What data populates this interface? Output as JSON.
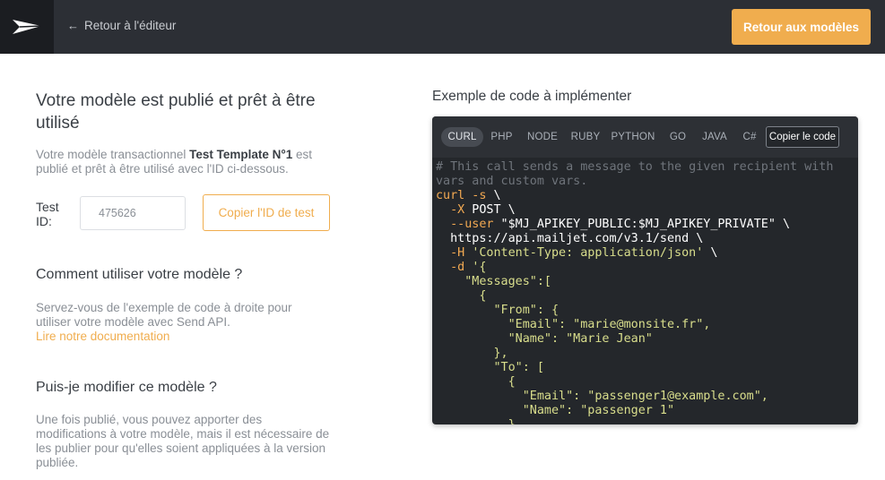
{
  "colors": {
    "topbar": "#2c2f35",
    "logo_box": "#1b1d21",
    "accent": "#f0ad4e",
    "code_bg": "#24272b",
    "code_keyword": "#f2a952",
    "code_string": "#d9de8c",
    "code_comment": "#6f747b"
  },
  "header": {
    "logo_icon": "paper-plane-icon",
    "back_icon": "arrow-left-icon",
    "back_label": "Retour à l'éditeur",
    "primary_button": "Retour aux modèles"
  },
  "left": {
    "title": "Votre modèle est publié et prêt à être utilisé",
    "desc_prefix": "Votre modèle transactionnel ",
    "template_name": "Test Template N°1",
    "desc_suffix": " est publié et prêt à être utilisé avec l'ID ci-dessous.",
    "test_id_label": "Test ID:",
    "test_id_value": "475626",
    "copy_id_button": "Copier l'ID de test",
    "how_title": "Comment utiliser votre modèle ?",
    "how_text": "Servez-vous de l'exemple de code à droite pour utiliser votre modèle avec Send API.",
    "how_link": "Lire notre documentation",
    "modify_title": "Puis-je modifier ce modèle ?",
    "modify_text": "Une fois publié, vous pouvez apporter des modifications à votre modèle, mais il est nécessaire de les publier pour qu'elles soient appliquées à la version publiée."
  },
  "code": {
    "title": "Exemple de code à implémenter",
    "tabs": [
      "CURL",
      "PHP",
      "NODE",
      "RUBY",
      "PYTHON",
      "GO",
      "JAVA",
      "C#"
    ],
    "active_tab": "CURL",
    "copy_button": "Copier le code",
    "lines": [
      [
        [
          "comment",
          "# This call sends a message to the given recipient with"
        ]
      ],
      [
        [
          "comment",
          "vars and custom vars."
        ]
      ],
      [
        [
          "key",
          "curl -s"
        ],
        [
          "text",
          " \\"
        ]
      ],
      [
        [
          "text",
          "  "
        ],
        [
          "key",
          "-X"
        ],
        [
          "text",
          " POST \\"
        ]
      ],
      [
        [
          "text",
          "  "
        ],
        [
          "key",
          "--user"
        ],
        [
          "text",
          " \"$MJ_APIKEY_PUBLIC:$MJ_APIKEY_PRIVATE\" \\"
        ]
      ],
      [
        [
          "text",
          "  https://api.mailjet.com/v3.1/send \\"
        ]
      ],
      [
        [
          "text",
          "  "
        ],
        [
          "key",
          "-H"
        ],
        [
          "text",
          " "
        ],
        [
          "str",
          "'Content-Type: application/json'"
        ],
        [
          "text",
          " \\"
        ]
      ],
      [
        [
          "text",
          "  "
        ],
        [
          "key",
          "-d"
        ],
        [
          "text",
          " "
        ],
        [
          "str",
          "'{"
        ]
      ],
      [
        [
          "str",
          "    \"Messages\":["
        ]
      ],
      [
        [
          "str",
          "      {"
        ]
      ],
      [
        [
          "str",
          "        \"From\": {"
        ]
      ],
      [
        [
          "str",
          "          \"Email\": \"marie@monsite.fr\","
        ]
      ],
      [
        [
          "str",
          "          \"Name\": \"Marie Jean\""
        ]
      ],
      [
        [
          "str",
          "        },"
        ]
      ],
      [
        [
          "str",
          "        \"To\": ["
        ]
      ],
      [
        [
          "str",
          "          {"
        ]
      ],
      [
        [
          "str",
          "            \"Email\": \"passenger1@example.com\","
        ]
      ],
      [
        [
          "str",
          "            \"Name\": \"passenger 1\""
        ]
      ],
      [
        [
          "str",
          "          }"
        ]
      ]
    ]
  }
}
